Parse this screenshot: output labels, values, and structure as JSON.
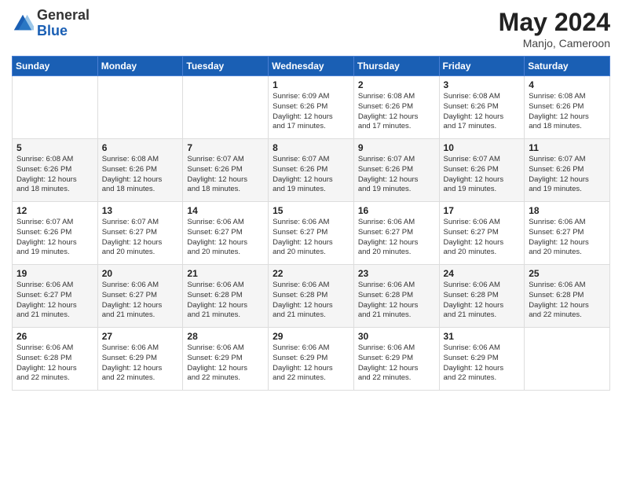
{
  "header": {
    "logo_general": "General",
    "logo_blue": "Blue",
    "month_year": "May 2024",
    "location": "Manjo, Cameroon"
  },
  "days_of_week": [
    "Sunday",
    "Monday",
    "Tuesday",
    "Wednesday",
    "Thursday",
    "Friday",
    "Saturday"
  ],
  "weeks": [
    [
      {
        "day": "",
        "info": ""
      },
      {
        "day": "",
        "info": ""
      },
      {
        "day": "",
        "info": ""
      },
      {
        "day": "1",
        "info": "Sunrise: 6:09 AM\nSunset: 6:26 PM\nDaylight: 12 hours\nand 17 minutes."
      },
      {
        "day": "2",
        "info": "Sunrise: 6:08 AM\nSunset: 6:26 PM\nDaylight: 12 hours\nand 17 minutes."
      },
      {
        "day": "3",
        "info": "Sunrise: 6:08 AM\nSunset: 6:26 PM\nDaylight: 12 hours\nand 17 minutes."
      },
      {
        "day": "4",
        "info": "Sunrise: 6:08 AM\nSunset: 6:26 PM\nDaylight: 12 hours\nand 18 minutes."
      }
    ],
    [
      {
        "day": "5",
        "info": "Sunrise: 6:08 AM\nSunset: 6:26 PM\nDaylight: 12 hours\nand 18 minutes."
      },
      {
        "day": "6",
        "info": "Sunrise: 6:08 AM\nSunset: 6:26 PM\nDaylight: 12 hours\nand 18 minutes."
      },
      {
        "day": "7",
        "info": "Sunrise: 6:07 AM\nSunset: 6:26 PM\nDaylight: 12 hours\nand 18 minutes."
      },
      {
        "day": "8",
        "info": "Sunrise: 6:07 AM\nSunset: 6:26 PM\nDaylight: 12 hours\nand 19 minutes."
      },
      {
        "day": "9",
        "info": "Sunrise: 6:07 AM\nSunset: 6:26 PM\nDaylight: 12 hours\nand 19 minutes."
      },
      {
        "day": "10",
        "info": "Sunrise: 6:07 AM\nSunset: 6:26 PM\nDaylight: 12 hours\nand 19 minutes."
      },
      {
        "day": "11",
        "info": "Sunrise: 6:07 AM\nSunset: 6:26 PM\nDaylight: 12 hours\nand 19 minutes."
      }
    ],
    [
      {
        "day": "12",
        "info": "Sunrise: 6:07 AM\nSunset: 6:26 PM\nDaylight: 12 hours\nand 19 minutes."
      },
      {
        "day": "13",
        "info": "Sunrise: 6:07 AM\nSunset: 6:27 PM\nDaylight: 12 hours\nand 20 minutes."
      },
      {
        "day": "14",
        "info": "Sunrise: 6:06 AM\nSunset: 6:27 PM\nDaylight: 12 hours\nand 20 minutes."
      },
      {
        "day": "15",
        "info": "Sunrise: 6:06 AM\nSunset: 6:27 PM\nDaylight: 12 hours\nand 20 minutes."
      },
      {
        "day": "16",
        "info": "Sunrise: 6:06 AM\nSunset: 6:27 PM\nDaylight: 12 hours\nand 20 minutes."
      },
      {
        "day": "17",
        "info": "Sunrise: 6:06 AM\nSunset: 6:27 PM\nDaylight: 12 hours\nand 20 minutes."
      },
      {
        "day": "18",
        "info": "Sunrise: 6:06 AM\nSunset: 6:27 PM\nDaylight: 12 hours\nand 20 minutes."
      }
    ],
    [
      {
        "day": "19",
        "info": "Sunrise: 6:06 AM\nSunset: 6:27 PM\nDaylight: 12 hours\nand 21 minutes."
      },
      {
        "day": "20",
        "info": "Sunrise: 6:06 AM\nSunset: 6:27 PM\nDaylight: 12 hours\nand 21 minutes."
      },
      {
        "day": "21",
        "info": "Sunrise: 6:06 AM\nSunset: 6:28 PM\nDaylight: 12 hours\nand 21 minutes."
      },
      {
        "day": "22",
        "info": "Sunrise: 6:06 AM\nSunset: 6:28 PM\nDaylight: 12 hours\nand 21 minutes."
      },
      {
        "day": "23",
        "info": "Sunrise: 6:06 AM\nSunset: 6:28 PM\nDaylight: 12 hours\nand 21 minutes."
      },
      {
        "day": "24",
        "info": "Sunrise: 6:06 AM\nSunset: 6:28 PM\nDaylight: 12 hours\nand 21 minutes."
      },
      {
        "day": "25",
        "info": "Sunrise: 6:06 AM\nSunset: 6:28 PM\nDaylight: 12 hours\nand 22 minutes."
      }
    ],
    [
      {
        "day": "26",
        "info": "Sunrise: 6:06 AM\nSunset: 6:28 PM\nDaylight: 12 hours\nand 22 minutes."
      },
      {
        "day": "27",
        "info": "Sunrise: 6:06 AM\nSunset: 6:29 PM\nDaylight: 12 hours\nand 22 minutes."
      },
      {
        "day": "28",
        "info": "Sunrise: 6:06 AM\nSunset: 6:29 PM\nDaylight: 12 hours\nand 22 minutes."
      },
      {
        "day": "29",
        "info": "Sunrise: 6:06 AM\nSunset: 6:29 PM\nDaylight: 12 hours\nand 22 minutes."
      },
      {
        "day": "30",
        "info": "Sunrise: 6:06 AM\nSunset: 6:29 PM\nDaylight: 12 hours\nand 22 minutes."
      },
      {
        "day": "31",
        "info": "Sunrise: 6:06 AM\nSunset: 6:29 PM\nDaylight: 12 hours\nand 22 minutes."
      },
      {
        "day": "",
        "info": ""
      }
    ]
  ]
}
